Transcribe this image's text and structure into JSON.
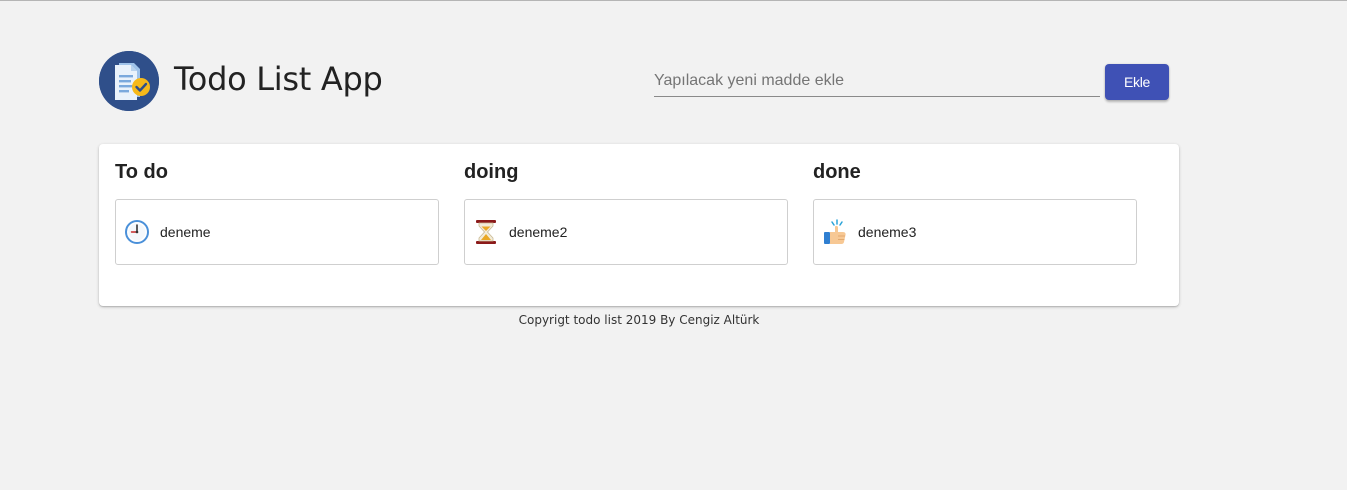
{
  "app": {
    "title": "Todo List App",
    "logo_icon": "document-check-icon"
  },
  "new_item": {
    "placeholder": "Yapılacak yeni madde ekle",
    "value": "",
    "add_label": "Ekle"
  },
  "colors": {
    "accent": "#3f51b5",
    "background": "#f2f2f2",
    "logo_bg": "#2f4f8a"
  },
  "columns": [
    {
      "title": "To do",
      "items": [
        {
          "label": "deneme",
          "icon": "clock-icon"
        }
      ]
    },
    {
      "title": "doing",
      "items": [
        {
          "label": "deneme2",
          "icon": "hourglass-icon"
        }
      ]
    },
    {
      "title": "done",
      "items": [
        {
          "label": "deneme3",
          "icon": "thumbs-up-icon"
        }
      ]
    }
  ],
  "footer": {
    "text": "Copyrigt todo list 2019 By Cengiz Altürk"
  }
}
